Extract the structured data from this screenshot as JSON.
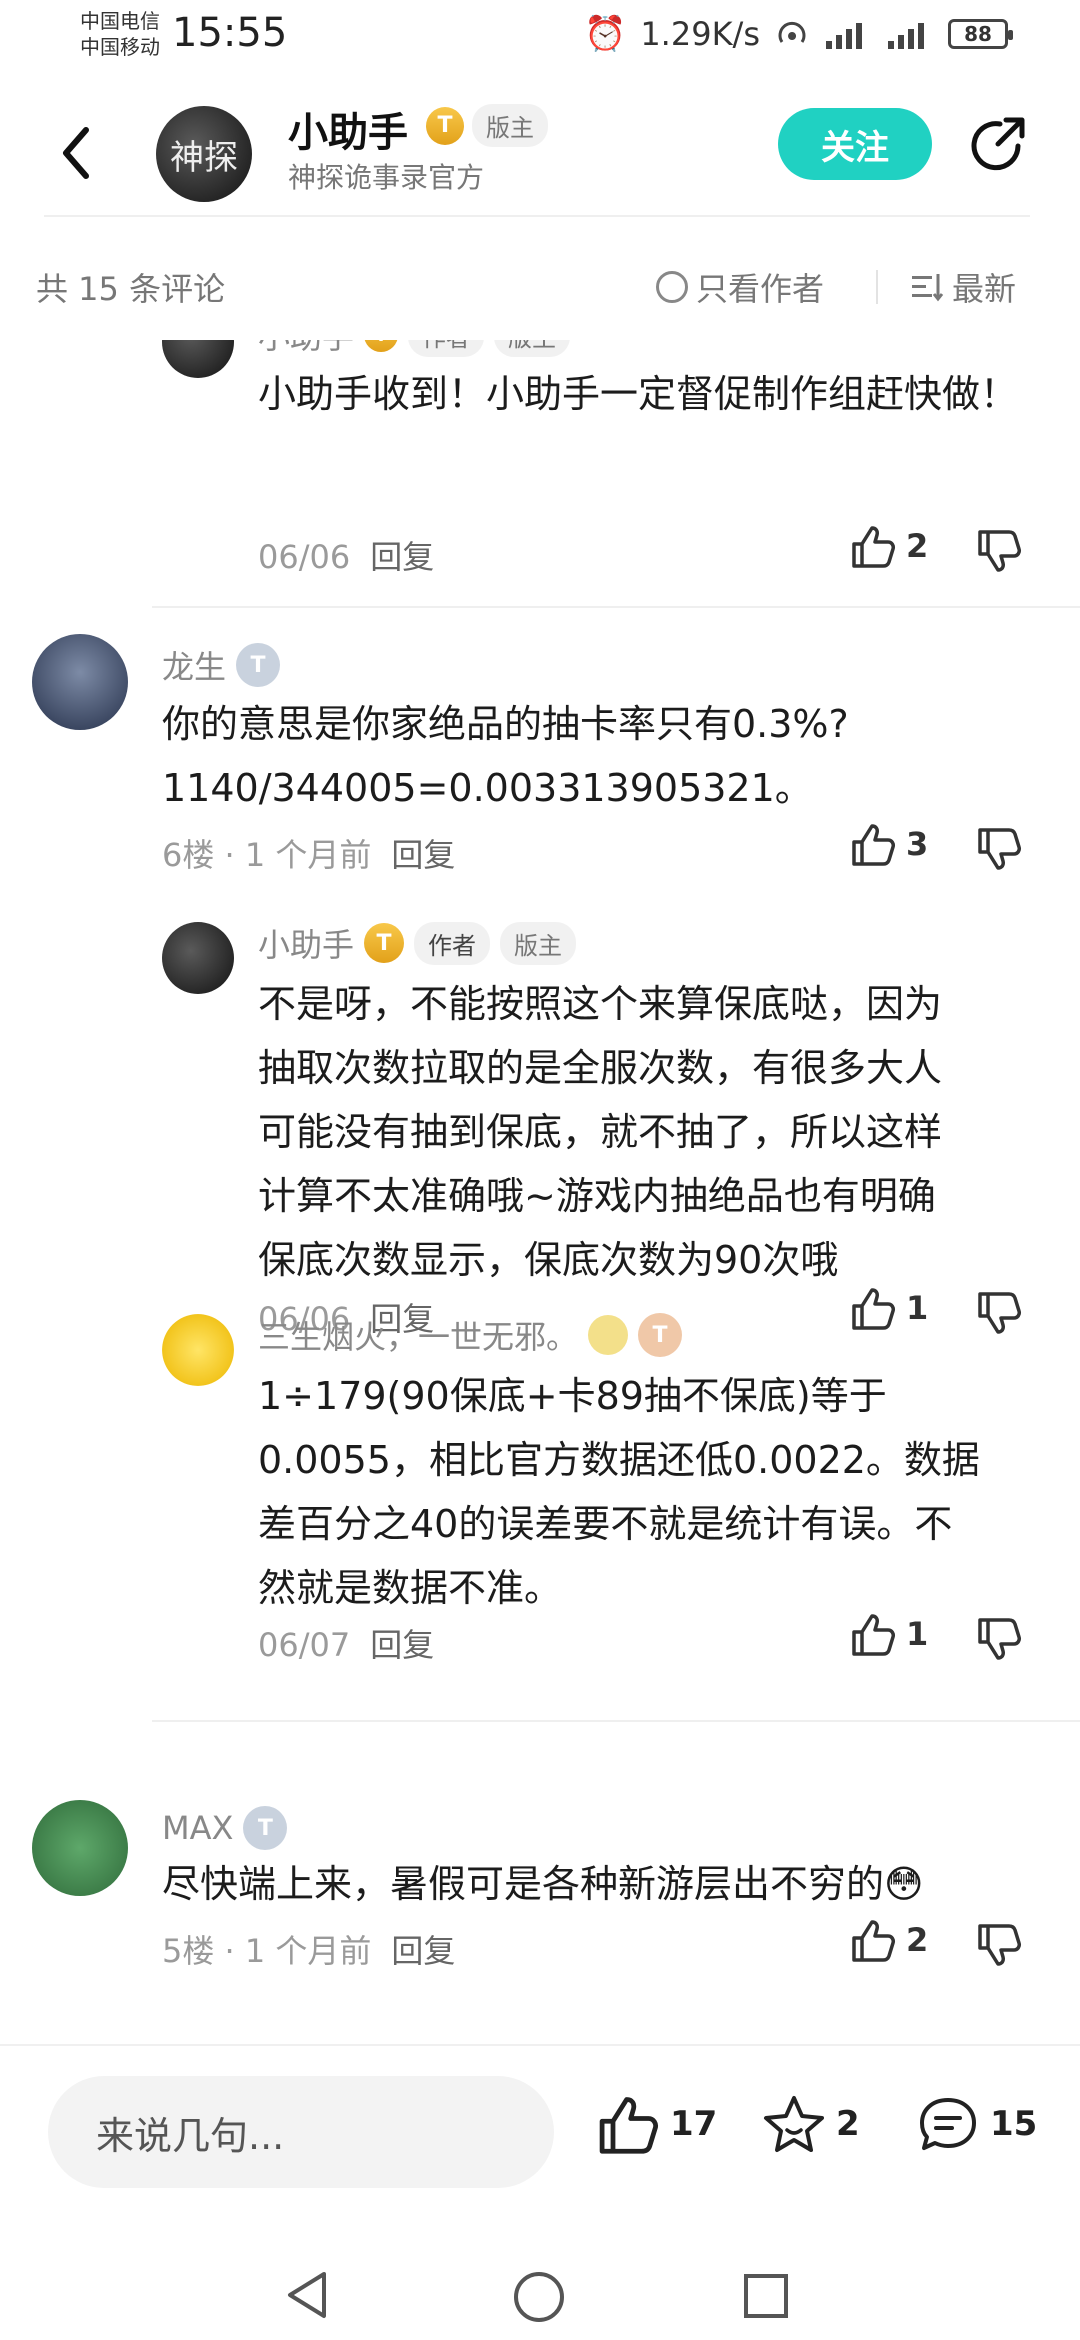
{
  "status": {
    "carrier1": "中国电信",
    "carrier2": "中国移动",
    "time": "15:55",
    "speed": "1.29K/s",
    "battery": "88"
  },
  "header": {
    "name": "小助手",
    "level": "T",
    "badge": "版主",
    "subtitle": "神探诡事录官方",
    "follow_label": "关注",
    "avatar_text": "神探"
  },
  "toolbar": {
    "count": "共 15 条评论",
    "only_author": "只看作者",
    "sort": "最新"
  },
  "comments": {
    "c0": {
      "name": "小助手",
      "tags": [
        "作者",
        "版主"
      ],
      "text": "小助手收到！小助手一定督促制作组赶快做！",
      "date": "06/06",
      "reply": "回复",
      "likes": "2"
    },
    "c1": {
      "name": "龙生",
      "level": "T",
      "text_lines": [
        "你的意思是你家绝品的抽卡率只有0.3%?",
        "1140/344005=0.003313905321。"
      ],
      "floor": "6楼 · 1 个月前",
      "reply": "回复",
      "likes": "3"
    },
    "c1r1": {
      "name": "小助手",
      "level": "T",
      "tags": [
        "作者",
        "版主"
      ],
      "text_lines": [
        "不是呀，不能按照这个来算保底哒，因为",
        "抽取次数拉取的是全服次数，有很多大人",
        "可能没有抽到保底，就不抽了，所以这样",
        "计算不太准确哦~游戏内抽绝品也有明确",
        "保底次数显示，保底次数为90次哦"
      ],
      "date": "06/06",
      "reply": "回复",
      "likes": "1"
    },
    "c1r2": {
      "name": "三生烟火，一世无邪。",
      "level": "T",
      "text_lines": [
        "1÷179(90保底+卡89抽不保底)等于",
        "0.0055，相比官方数据还低0.0022。数据",
        "差百分之40的误差要不就是统计有误。不",
        "然就是数据不准。"
      ],
      "date": "06/07",
      "reply": "回复",
      "likes": "1"
    },
    "c2": {
      "name": "MAX",
      "level": "T",
      "text": "尽快端上来，暑假可是各种新游层出不穷的😳",
      "floor": "5楼 · 1 个月前",
      "reply": "回复",
      "likes": "2"
    }
  },
  "bottom": {
    "input_placeholder": "来说几句...",
    "likes": "17",
    "favorites": "2",
    "comments": "15"
  }
}
